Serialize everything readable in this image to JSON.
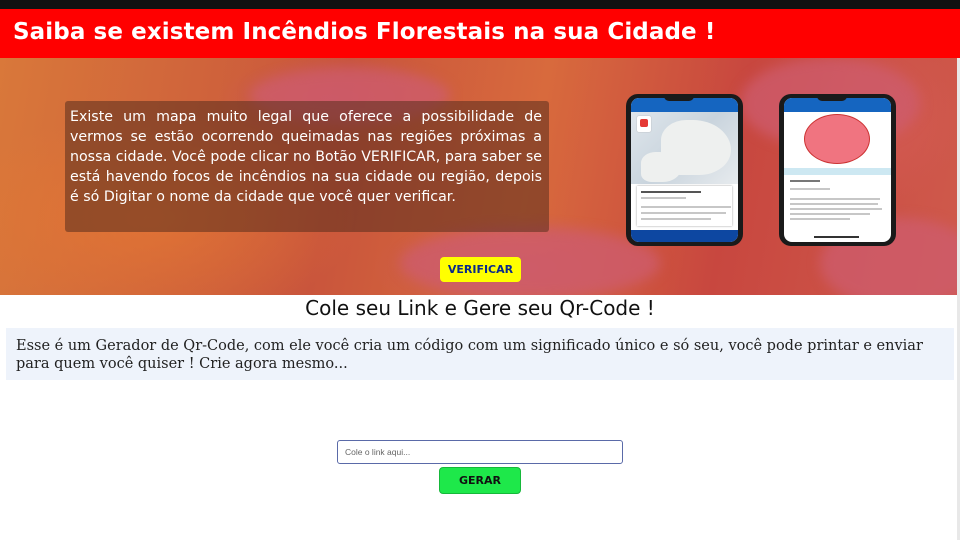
{
  "header": {
    "title": "Saiba se existem Incêndios Florestais na sua Cidade !"
  },
  "hero": {
    "paragraph": "Existe um mapa muito legal que oferece a possibilidade de vermos se estão ocorrendo queimadas nas regiões próximas a nossa cidade. Você pode clicar no Botão VERIFICAR, para saber se está havendo focos de incêndios na sua cidade ou região, depois é só Digitar o nome da cidade que você quer verificar.",
    "verify_button_label": "VERIFICAR"
  },
  "qrcode": {
    "title": "Cole seu Link e Gere seu Qr-Code !",
    "description": "Esse é um Gerador de Qr-Code, com ele você cria um código com um significado único e só seu, você pode printar e enviar para quem você quiser ! Crie agora mesmo...",
    "input_placeholder": "Cole o link aqui...",
    "input_value": "",
    "generate_button_label": "GERAR"
  },
  "colors": {
    "title_bar": "#ff0000",
    "verify_button": "#ffff00",
    "generate_button": "#1ee84a",
    "info_box": "#eef3fb"
  }
}
